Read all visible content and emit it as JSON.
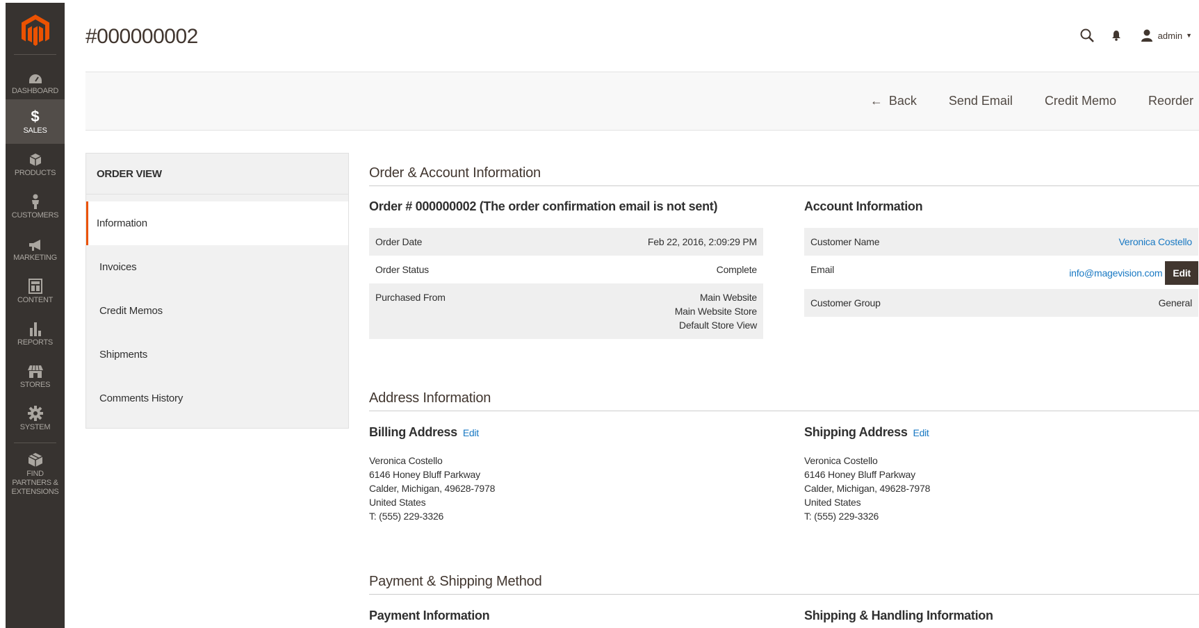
{
  "nav": {
    "items": [
      {
        "label": "DASHBOARD",
        "icon": "dashboard-icon"
      },
      {
        "label": "SALES",
        "icon": "dollar-icon"
      },
      {
        "label": "PRODUCTS",
        "icon": "box-icon"
      },
      {
        "label": "CUSTOMERS",
        "icon": "person-icon"
      },
      {
        "label": "MARKETING",
        "icon": "megaphone-icon"
      },
      {
        "label": "CONTENT",
        "icon": "layout-icon"
      },
      {
        "label": "REPORTS",
        "icon": "bar-chart-icon"
      },
      {
        "label": "STORES",
        "icon": "storefront-icon"
      },
      {
        "label": "SYSTEM",
        "icon": "gear-icon"
      },
      {
        "label": "FIND PARTNERS & EXTENSIONS",
        "icon": "cube-icon"
      }
    ],
    "active": "SALES"
  },
  "header": {
    "title": "#000000002",
    "user": "admin"
  },
  "actions": {
    "back": "Back",
    "send_email": "Send Email",
    "credit_memo": "Credit Memo",
    "reorder": "Reorder"
  },
  "tabs": {
    "title": "ORDER VIEW",
    "items": [
      "Information",
      "Invoices",
      "Credit Memos",
      "Shipments",
      "Comments History"
    ],
    "active": "Information"
  },
  "order_account": {
    "section_title": "Order & Account Information",
    "order_heading": "Order # 000000002 (The order confirmation email is not sent)",
    "order_rows": [
      {
        "label": "Order Date",
        "value": "Feb 22, 2016, 2:09:29 PM"
      },
      {
        "label": "Order Status",
        "value": "Complete"
      },
      {
        "label": "Purchased From",
        "value_lines": [
          "Main Website",
          "Main Website Store",
          "Default Store View"
        ]
      }
    ],
    "account_heading": "Account Information",
    "account_rows": {
      "customer_name_label": "Customer Name",
      "customer_name": "Veronica Costello",
      "email_label": "Email",
      "email": "info@magevision.com",
      "edit_button": "Edit",
      "group_label": "Customer Group",
      "group": "General"
    }
  },
  "address": {
    "section_title": "Address Information",
    "billing_heading": "Billing Address",
    "shipping_heading": "Shipping Address",
    "edit_link": "Edit",
    "billing_lines": [
      "Veronica Costello",
      "6146 Honey Bluff Parkway",
      "Calder, Michigan, 49628-7978",
      "United States",
      "T: (555) 229-3326"
    ],
    "shipping_lines": [
      "Veronica Costello",
      "6146 Honey Bluff Parkway",
      "Calder, Michigan, 49628-7978",
      "United States",
      "T: (555) 229-3326"
    ]
  },
  "payment_shipping": {
    "section_title": "Payment & Shipping Method",
    "payment_heading": "Payment Information",
    "shipping_heading": "Shipping & Handling Information"
  },
  "colors": {
    "accent": "#eb5202",
    "nav_bg": "#373330",
    "nav_active": "#524d49",
    "link": "#1979c3",
    "edit_button": "#41362f"
  }
}
